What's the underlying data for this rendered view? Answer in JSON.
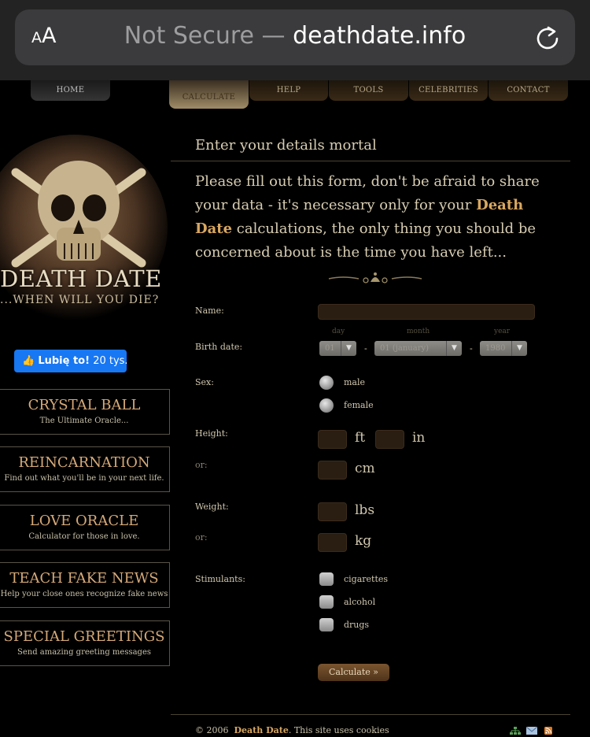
{
  "browser": {
    "aa_small": "A",
    "aa_big": "A",
    "not_secure": "Not Secure",
    "separator": " — ",
    "domain": "deathdate.info"
  },
  "nav": {
    "home": "HOME",
    "calculate": "CALCULATE",
    "help": "HELP",
    "tools": "TOOLS",
    "celebrities": "CELEBRITIES",
    "contact": "CONTACT"
  },
  "logo": {
    "title": "DEATH DATE",
    "subtitle": "...WHEN WILL YOU DIE?"
  },
  "facebook": {
    "like_label": "Lubię to!",
    "count": "20 tys."
  },
  "sidebar": [
    {
      "title": "CRYSTAL BALL",
      "subtitle": "The Ultimate Oracle..."
    },
    {
      "title": "REINCARNATION",
      "subtitle": "Find out what you'll be in your next life."
    },
    {
      "title": "LOVE ORACLE",
      "subtitle": "Calculator for those in love."
    },
    {
      "title": "TEACH FAKE NEWS",
      "subtitle": "Help your close ones recognize fake news"
    },
    {
      "title": "SPECIAL GREETINGS",
      "subtitle": "Send amazing greeting messages"
    }
  ],
  "form": {
    "heading": "Enter your details mortal",
    "intro_before": "Please fill out this form, don't be afraid to share your data - it's necessary only for your ",
    "intro_highlight": "Death Date",
    "intro_after": " calculations, the only thing you should be concerned about is the time you have left...",
    "name_label": "Name:",
    "birth_label": "Birth date:",
    "day_caption": "day",
    "month_caption": "month",
    "year_caption": "year",
    "day_value": "01",
    "month_value": "01 (january)",
    "year_value": "1980",
    "dash": "-",
    "sex_label": "Sex:",
    "male": "male",
    "female": "female",
    "height_label": "Height:",
    "or": "or:",
    "ft": "ft",
    "in": "in",
    "cm": "cm",
    "weight_label": "Weight:",
    "lbs": "lbs",
    "kg": "kg",
    "stimulants_label": "Stimulants:",
    "cigarettes": "cigarettes",
    "alcohol": "alcohol",
    "drugs": "drugs",
    "calculate_button": "Calculate »"
  },
  "footer": {
    "year": "© 2006",
    "brand": "Death Date",
    "rest": ". This site uses cookies"
  }
}
